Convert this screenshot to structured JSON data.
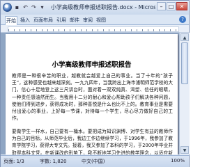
{
  "window": {
    "title": "小学高级教师申报述职报告.docx - Microsoft Word",
    "controls": {
      "minimize": "–",
      "maximize": "□",
      "close": "✕"
    }
  },
  "quick_access": {
    "save": "▪",
    "undo": "↶",
    "redo": "↷",
    "more": "▾"
  },
  "ribbon": {
    "tabs": [
      "开始",
      "插入",
      "页面布局",
      "引用",
      "邮件",
      "审阅",
      "视图"
    ],
    "help": "?"
  },
  "document": {
    "title": "小学高级教师申报述职报告",
    "paragraphs": [
      "教师是一种很辛苦的职业，越教就会越爱上自己的事业。当了十年的“孩子王”，这种感受也越来越深刻。一九九四年，当我跨出上海市浦明师范学校的大门，信心十足地登上这三尺讲台时，面对着一双双纯真、渴望、信任的眼睛，一种责任感油然而生。当我用十二分的耐心和爱心帮助孩子们解决各种问题，使他们得到进步，获得成功时，那种喜悦是什么也比不上的。教育事业是需要付出爱心的事业，上好每一节课，对待每一个学生，尽心尽力做好自己的工作。",
      "要做学生一样水，自己要有一桶水。要把成为知识渊博、对学生有益的教师作为自己的目标。从师范毕业后，我边工作边继续学习，于1996年，我参加了教育学院学习，获得大专文凭。接着，我又参加了本科的学习，于2000年毕业并取得本科文凭。在新课改的形势下，我不断地学习先进的教学理念，以适应新形势对教师的要求。"
    ]
  },
  "scrollbar": {
    "up": "▲",
    "down": "▼"
  },
  "statusbar": {
    "page": "页面: 1/3",
    "words": "字数: 1,820",
    "language": "中文(中国)",
    "zoom": "100%"
  }
}
